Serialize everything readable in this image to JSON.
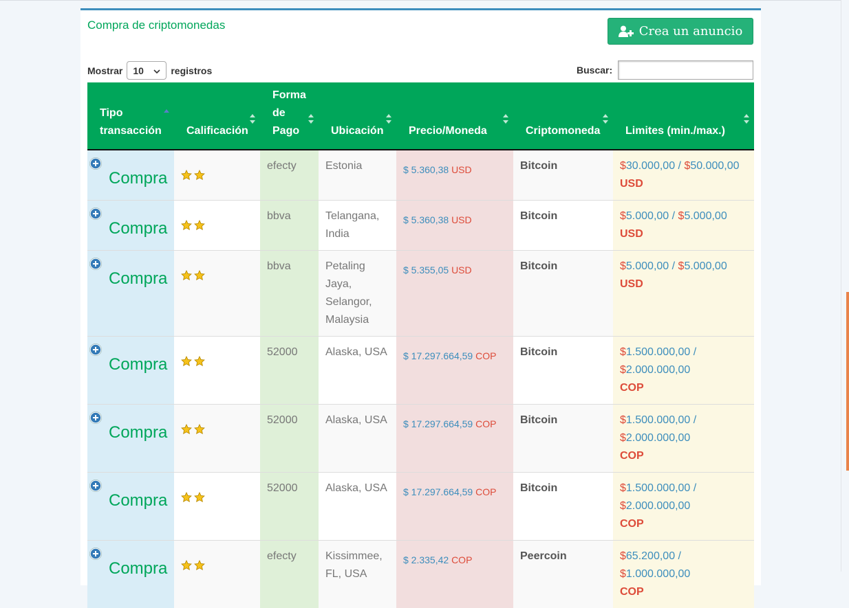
{
  "panel": {
    "title": "Compra de criptomonedas",
    "create_button_label": "Crea un anuncio"
  },
  "length": {
    "prefix": "Mostrar",
    "value": "10",
    "suffix": "registros"
  },
  "search": {
    "label": "Buscar:",
    "value": ""
  },
  "columns": [
    {
      "lines": [
        "Tipo",
        "transacción"
      ],
      "sort": "asc"
    },
    {
      "lines": [
        "Calificación"
      ],
      "sort": "both"
    },
    {
      "lines": [
        "Forma",
        "de",
        "Pago"
      ],
      "sort": "both"
    },
    {
      "lines": [
        "Ubicación"
      ],
      "sort": "both"
    },
    {
      "lines": [
        "Precio/Moneda"
      ],
      "sort": "both"
    },
    {
      "lines": [
        "Criptomoneda"
      ],
      "sort": "both"
    },
    {
      "lines": [
        "Limites (min./max.)"
      ],
      "sort": "both"
    }
  ],
  "rows": [
    {
      "tipo": "Compra",
      "stars": 2,
      "forma": "efecty",
      "ubic_lines": [
        "Estonia"
      ],
      "precio": "$ 5.360,38",
      "moneda": "USD",
      "cripto": "Bitcoin",
      "lim_min": "30.000,00",
      "lim_max": "50.000,00",
      "lim_cur": "USD",
      "lim_layout": "inline"
    },
    {
      "tipo": "Compra",
      "stars": 2,
      "forma": "bbva",
      "ubic_lines": [
        "Telangana,",
        "India"
      ],
      "precio": "$ 5.360,38",
      "moneda": "USD",
      "cripto": "Bitcoin",
      "lim_min": "5.000,00",
      "lim_max": "5.000,00",
      "lim_cur": "USD",
      "lim_layout": "inline"
    },
    {
      "tipo": "Compra",
      "stars": 2,
      "forma": "bbva",
      "ubic_lines": [
        "Petaling",
        "Jaya,",
        "Selangor,",
        "Malaysia"
      ],
      "precio": "$ 5.355,05",
      "moneda": "USD",
      "cripto": "Bitcoin",
      "lim_min": "5.000,00",
      "lim_max": "5.000,00",
      "lim_cur": "USD",
      "lim_layout": "inline"
    },
    {
      "tipo": "Compra",
      "stars": 2,
      "forma": "52000",
      "ubic_lines": [
        "Alaska, USA"
      ],
      "precio": "$ 17.297.664,59",
      "moneda": "COP",
      "cripto": "Bitcoin",
      "lim_min": "1.500.000,00",
      "lim_max": "2.000.000,00",
      "lim_cur": "COP",
      "lim_layout": "stacked"
    },
    {
      "tipo": "Compra",
      "stars": 2,
      "forma": "52000",
      "ubic_lines": [
        "Alaska, USA"
      ],
      "precio": "$ 17.297.664,59",
      "moneda": "COP",
      "cripto": "Bitcoin",
      "lim_min": "1.500.000,00",
      "lim_max": "2.000.000,00",
      "lim_cur": "COP",
      "lim_layout": "stacked"
    },
    {
      "tipo": "Compra",
      "stars": 2,
      "forma": "52000",
      "ubic_lines": [
        "Alaska, USA"
      ],
      "precio": "$ 17.297.664,59",
      "moneda": "COP",
      "cripto": "Bitcoin",
      "lim_min": "1.500.000,00",
      "lim_max": "2.000.000,00",
      "lim_cur": "COP",
      "lim_layout": "stacked"
    },
    {
      "tipo": "Compra",
      "stars": 2,
      "forma": "efecty",
      "ubic_lines": [
        "Kissimmee,",
        "FL, USA"
      ],
      "precio": "$ 2.335,42",
      "moneda": "COP",
      "cripto": "Peercoin",
      "lim_min": "65.200,00",
      "lim_max": "1.000.000,00",
      "lim_cur": "COP",
      "lim_layout": "stacked"
    }
  ],
  "colors": {
    "header_green": "#00a65a",
    "accent_blue": "#3c8dbc",
    "accent_red": "#dd4b39",
    "button_green": "#25b279"
  },
  "icons": {
    "create_button": "user-plus-icon",
    "expand": "plus-circle-icon",
    "rating": "star-icon",
    "sort": "sort-icon"
  }
}
